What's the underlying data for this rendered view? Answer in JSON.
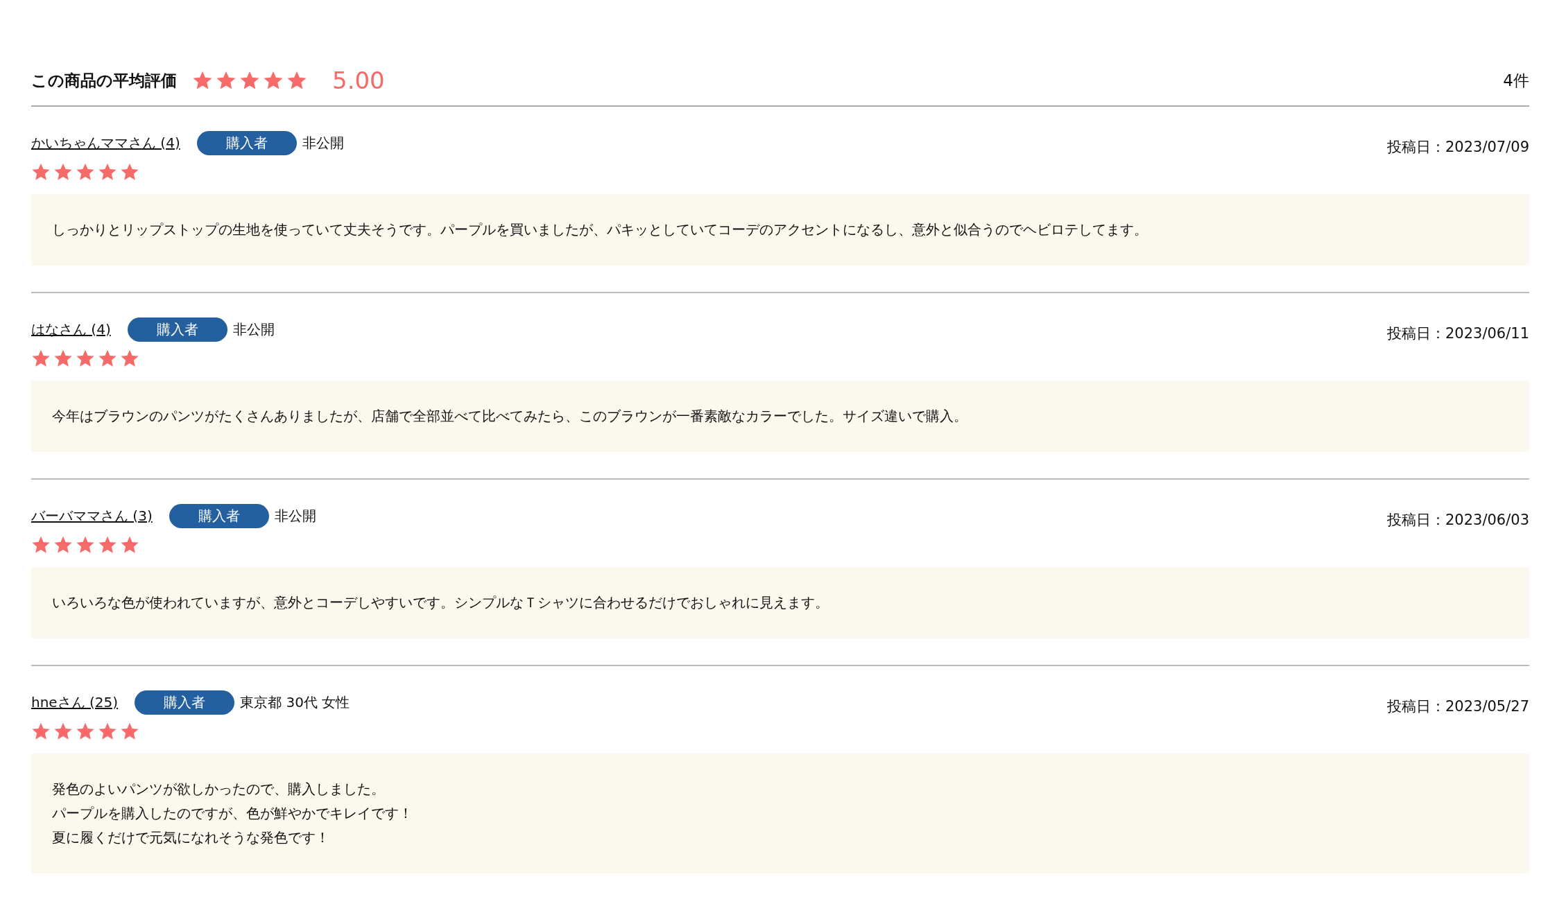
{
  "summary": {
    "title": "この商品の平均評価",
    "stars": 5,
    "score": "5.00",
    "count": "4件"
  },
  "reviews": [
    {
      "name": "かいちゃんママさん (4)",
      "badge": "購入者",
      "profile": "非公開",
      "date": "投稿日：2023/07/09",
      "stars": 5,
      "comment": [
        "しっかりとリップストップの生地を使っていて丈夫そうです。パープルを買いましたが、パキッとしていてコーデのアクセントになるし、意外と似合うのでヘビロテしてます。"
      ]
    },
    {
      "name": "はなさん (4)",
      "badge": "購入者",
      "profile": "非公開",
      "date": "投稿日：2023/06/11",
      "stars": 5,
      "comment": [
        "今年はブラウンのパンツがたくさんありましたが、店舗で全部並べて比べてみたら、このブラウンが一番素敵なカラーでした。サイズ違いで購入。"
      ]
    },
    {
      "name": "バーバママさん (3)",
      "badge": "購入者",
      "profile": "非公開",
      "date": "投稿日：2023/06/03",
      "stars": 5,
      "comment": [
        "いろいろな色が使われていますが、意外とコーデしやすいです。シンプルなＴシャツに合わせるだけでおしゃれに見えます。"
      ]
    },
    {
      "name": "hneさん (25)",
      "badge": "購入者",
      "profile": "東京都 30代 女性",
      "date": "投稿日：2023/05/27",
      "stars": 5,
      "comment": [
        "発色のよいパンツが欲しかったので、購入しました。",
        "パープルを購入したのですが、色が鮮やかでキレイです！",
        "夏に履くだけで元気になれそうな発色です！"
      ]
    }
  ]
}
